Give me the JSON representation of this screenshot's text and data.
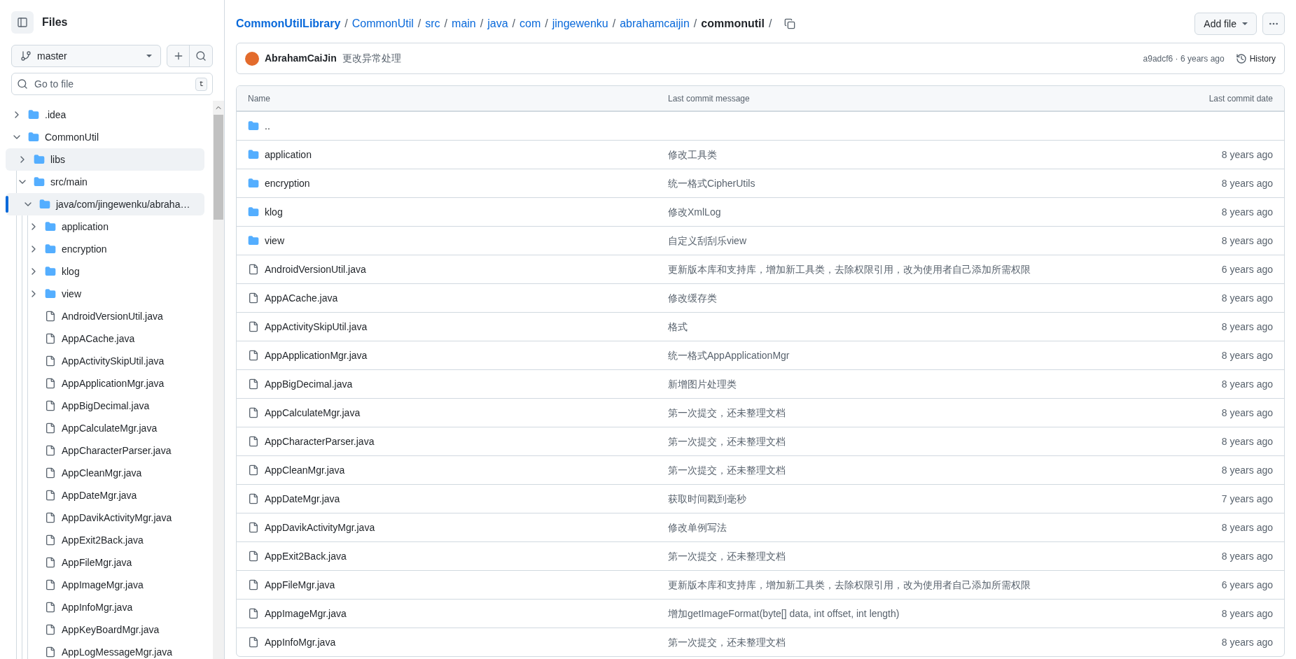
{
  "sidebar": {
    "title": "Files",
    "branch": "master",
    "search": {
      "placeholder": "Go to file",
      "shortcut": "t"
    },
    "tree": [
      {
        "kind": "folder",
        "name": ".idea",
        "expanded": false,
        "selected": false,
        "hovered": false
      },
      {
        "kind": "folder",
        "name": "CommonUtil",
        "expanded": true,
        "selected": false,
        "hovered": false,
        "children": [
          {
            "kind": "folder",
            "name": "libs",
            "expanded": false,
            "selected": false,
            "hovered": true
          },
          {
            "kind": "folder",
            "name": "src/main",
            "expanded": true,
            "selected": false,
            "hovered": false,
            "children": [
              {
                "kind": "folder",
                "name": "java/com/jingewenku/abraha…",
                "expanded": true,
                "selected": true,
                "hovered": false,
                "children": [
                  {
                    "kind": "folder",
                    "name": "application",
                    "expanded": false,
                    "selected": false,
                    "hovered": false
                  },
                  {
                    "kind": "folder",
                    "name": "encryption",
                    "expanded": false,
                    "selected": false,
                    "hovered": false
                  },
                  {
                    "kind": "folder",
                    "name": "klog",
                    "expanded": false,
                    "selected": false,
                    "hovered": false
                  },
                  {
                    "kind": "folder",
                    "name": "view",
                    "expanded": false,
                    "selected": false,
                    "hovered": false
                  },
                  {
                    "kind": "file",
                    "name": "AndroidVersionUtil.java",
                    "selected": false,
                    "hovered": false
                  },
                  {
                    "kind": "file",
                    "name": "AppACache.java",
                    "selected": false,
                    "hovered": false
                  },
                  {
                    "kind": "file",
                    "name": "AppActivitySkipUtil.java",
                    "selected": false,
                    "hovered": false
                  },
                  {
                    "kind": "file",
                    "name": "AppApplicationMgr.java",
                    "selected": false,
                    "hovered": false
                  },
                  {
                    "kind": "file",
                    "name": "AppBigDecimal.java",
                    "selected": false,
                    "hovered": false
                  },
                  {
                    "kind": "file",
                    "name": "AppCalculateMgr.java",
                    "selected": false,
                    "hovered": false
                  },
                  {
                    "kind": "file",
                    "name": "AppCharacterParser.java",
                    "selected": false,
                    "hovered": false
                  },
                  {
                    "kind": "file",
                    "name": "AppCleanMgr.java",
                    "selected": false,
                    "hovered": false
                  },
                  {
                    "kind": "file",
                    "name": "AppDateMgr.java",
                    "selected": false,
                    "hovered": false
                  },
                  {
                    "kind": "file",
                    "name": "AppDavikActivityMgr.java",
                    "selected": false,
                    "hovered": false
                  },
                  {
                    "kind": "file",
                    "name": "AppExit2Back.java",
                    "selected": false,
                    "hovered": false
                  },
                  {
                    "kind": "file",
                    "name": "AppFileMgr.java",
                    "selected": false,
                    "hovered": false
                  },
                  {
                    "kind": "file",
                    "name": "AppImageMgr.java",
                    "selected": false,
                    "hovered": false
                  },
                  {
                    "kind": "file",
                    "name": "AppInfoMgr.java",
                    "selected": false,
                    "hovered": false
                  },
                  {
                    "kind": "file",
                    "name": "AppKeyBoardMgr.java",
                    "selected": false,
                    "hovered": false
                  },
                  {
                    "kind": "file",
                    "name": "AppLogMessageMgr.java",
                    "selected": false,
                    "hovered": false
                  }
                ]
              }
            ]
          }
        ]
      }
    ]
  },
  "breadcrumb": {
    "repo": "CommonUtilLibrary",
    "links": [
      "CommonUtil",
      "src",
      "main",
      "java",
      "com",
      "jingewenku",
      "abrahamcaijin"
    ],
    "current": "commonutil",
    "separator": "/"
  },
  "actions": {
    "add_file": "Add file"
  },
  "latest_commit": {
    "author": "AbrahamCaiJin",
    "message": "更改异常处理",
    "sha_time": "a9adcf6 · 6 years ago",
    "history": "History"
  },
  "table": {
    "columns": [
      "Name",
      "Last commit message",
      "Last commit date"
    ],
    "rows": [
      {
        "kind": "parent",
        "name": ".."
      },
      {
        "kind": "folder",
        "name": "application",
        "message": "修改工具类",
        "date": "8 years ago"
      },
      {
        "kind": "folder",
        "name": "encryption",
        "message": "统一格式CipherUtils",
        "date": "8 years ago"
      },
      {
        "kind": "folder",
        "name": "klog",
        "message": "修改XmlLog",
        "date": "8 years ago"
      },
      {
        "kind": "folder",
        "name": "view",
        "message": "自定义刮刮乐view",
        "date": "8 years ago"
      },
      {
        "kind": "file",
        "name": "AndroidVersionUtil.java",
        "message": "更新版本库和支持库，增加新工具类，去除权限引用，改为使用者自己添加所需权限",
        "date": "6 years ago"
      },
      {
        "kind": "file",
        "name": "AppACache.java",
        "message": "修改缓存类",
        "date": "8 years ago"
      },
      {
        "kind": "file",
        "name": "AppActivitySkipUtil.java",
        "message": "格式",
        "date": "8 years ago"
      },
      {
        "kind": "file",
        "name": "AppApplicationMgr.java",
        "message": "统一格式AppApplicationMgr",
        "date": "8 years ago"
      },
      {
        "kind": "file",
        "name": "AppBigDecimal.java",
        "message": "新增图片处理类",
        "date": "8 years ago"
      },
      {
        "kind": "file",
        "name": "AppCalculateMgr.java",
        "message": "第一次提交，还未整理文档",
        "date": "8 years ago"
      },
      {
        "kind": "file",
        "name": "AppCharacterParser.java",
        "message": "第一次提交，还未整理文档",
        "date": "8 years ago"
      },
      {
        "kind": "file",
        "name": "AppCleanMgr.java",
        "message": "第一次提交，还未整理文档",
        "date": "8 years ago"
      },
      {
        "kind": "file",
        "name": "AppDateMgr.java",
        "message": "获取时间戳到毫秒",
        "date": "7 years ago"
      },
      {
        "kind": "file",
        "name": "AppDavikActivityMgr.java",
        "message": "修改单例写法",
        "date": "8 years ago"
      },
      {
        "kind": "file",
        "name": "AppExit2Back.java",
        "message": "第一次提交，还未整理文档",
        "date": "8 years ago"
      },
      {
        "kind": "file",
        "name": "AppFileMgr.java",
        "message": "更新版本库和支持库，增加新工具类，去除权限引用，改为使用者自己添加所需权限",
        "date": "6 years ago"
      },
      {
        "kind": "file",
        "name": "AppImageMgr.java",
        "message": "增加getImageFormat(byte[] data, int offset, int length)",
        "date": "8 years ago"
      },
      {
        "kind": "file",
        "name": "AppInfoMgr.java",
        "message": "第一次提交，还未整理文档",
        "date": "8 years ago"
      }
    ]
  }
}
